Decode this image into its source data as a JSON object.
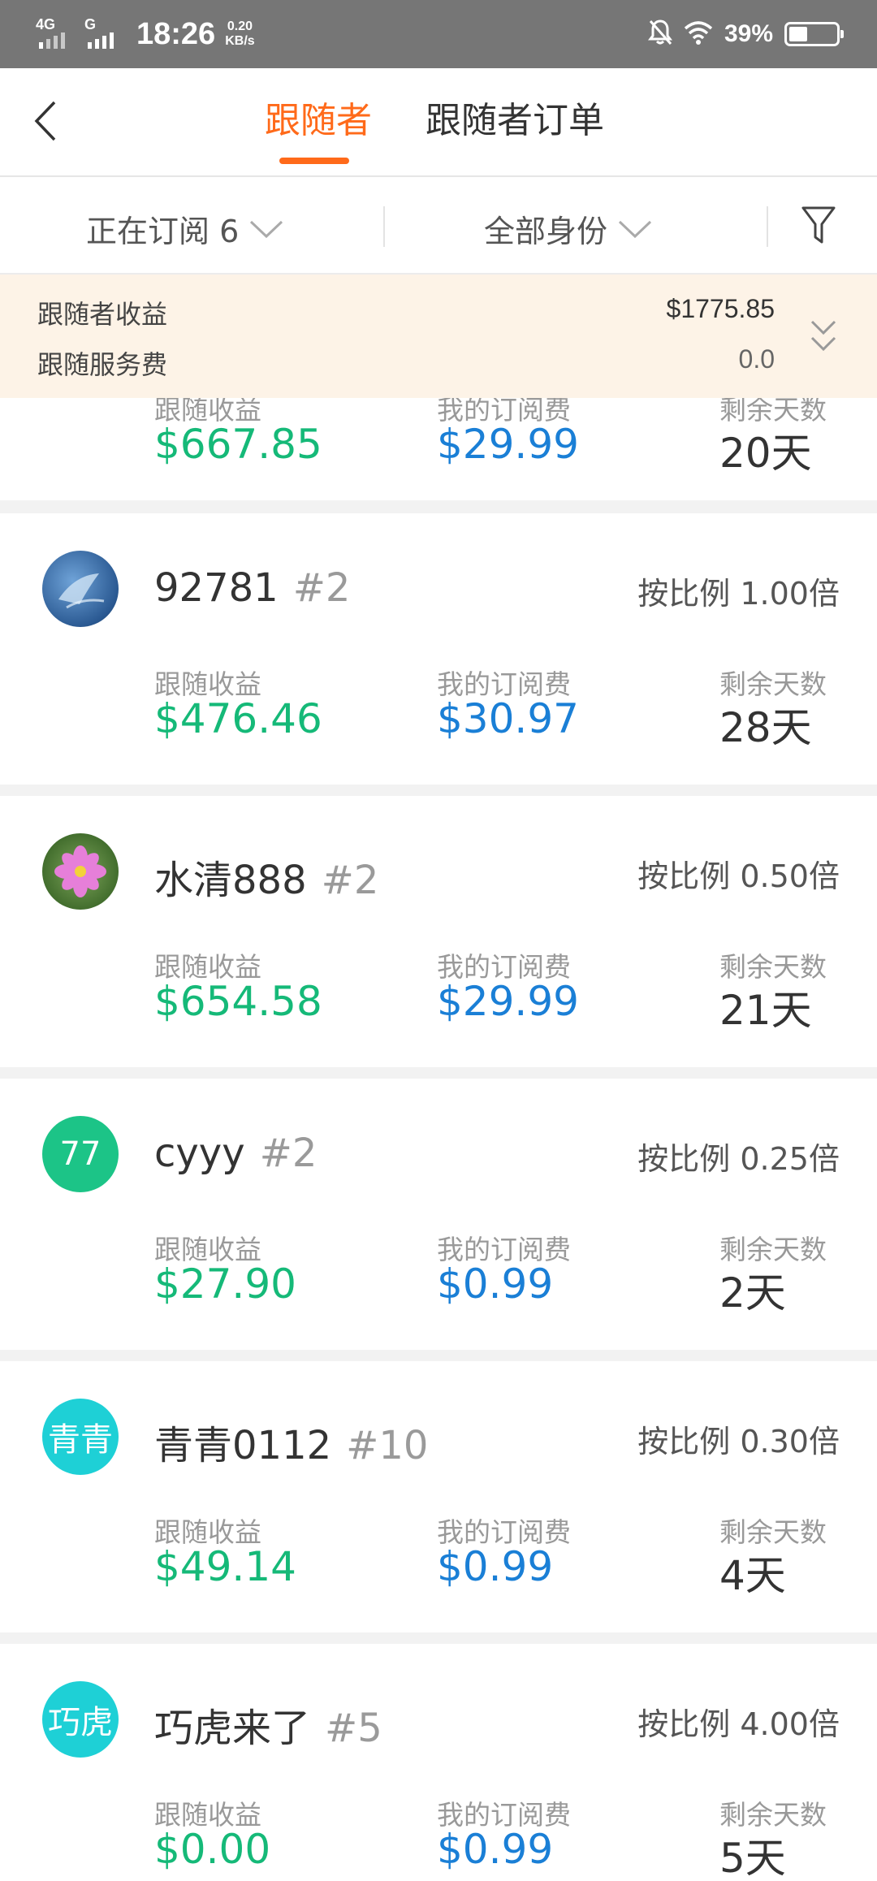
{
  "status_bar": {
    "network_1": "4G",
    "network_2": "G",
    "time": "18:26",
    "speed_value": "0.20",
    "speed_unit": "KB/s",
    "battery": "39%",
    "battery_level": 0.39
  },
  "header": {
    "tabs": [
      {
        "label": "跟随者",
        "active": true
      },
      {
        "label": "跟随者订单",
        "active": false
      }
    ]
  },
  "filters": {
    "subscription": "正在订阅 6",
    "role": "全部身份"
  },
  "summary": {
    "income_label": "跟随者收益",
    "income_value": "$1775.85",
    "fee_label": "跟随服务费",
    "fee_value": "0.0"
  },
  "labels": {
    "income": "跟随收益",
    "fee": "我的订阅费",
    "days": "剩余天数"
  },
  "partial_card": {
    "income": "$667.85",
    "fee": "$29.99",
    "days": "20天"
  },
  "followers": [
    {
      "name": "92781",
      "rank": "#2",
      "ratio": "按比例 1.00倍",
      "income": "$476.46",
      "fee": "$30.97",
      "days": "28天",
      "avatar_type": "image-blue"
    },
    {
      "name": "水清888",
      "rank": "#2",
      "ratio": "按比例 0.50倍",
      "income": "$654.58",
      "fee": "$29.99",
      "days": "21天",
      "avatar_type": "image-flower"
    },
    {
      "name": "cyyy",
      "rank": "#2",
      "ratio": "按比例 0.25倍",
      "income": "$27.90",
      "fee": "$0.99",
      "days": "2天",
      "avatar_text": "77",
      "avatar_color": "#1cc487"
    },
    {
      "name": "青青0112",
      "rank": "#10",
      "ratio": "按比例 0.30倍",
      "income": "$49.14",
      "fee": "$0.99",
      "days": "4天",
      "avatar_text": "青青",
      "avatar_color": "#1ed0d6"
    },
    {
      "name": "巧虎来了",
      "rank": "#5",
      "ratio": "按比例 4.00倍",
      "income": "$0.00",
      "fee": "$0.99",
      "days": "5天",
      "avatar_text": "巧虎",
      "avatar_color": "#1ed0d6"
    }
  ],
  "colors": {
    "accent": "#ff6a1a",
    "income_green": "#15b978",
    "fee_blue": "#1a7fd6",
    "summary_bg": "#fdf3e7"
  }
}
